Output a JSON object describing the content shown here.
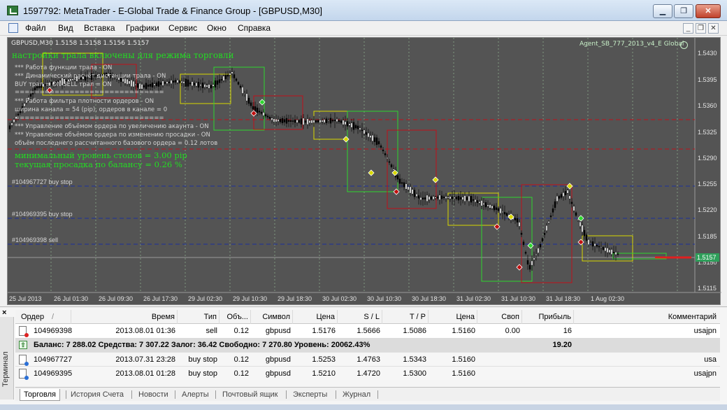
{
  "window": {
    "title": "1597792: MetaTrader - E-Global Trade & Finance Group - [GBPUSD,M30]",
    "min": "▁",
    "max": "❐",
    "close": "✕"
  },
  "menu": {
    "items": [
      "Файл",
      "Вид",
      "Вставка",
      "Графики",
      "Сервис",
      "Окно",
      "Справка"
    ],
    "mdi_min": "_",
    "mdi_restore": "❐",
    "mdi_close": "✕"
  },
  "chart": {
    "symbol_info": "GBPUSD,M30  1.5158 1.5158 1.5156 1.5157",
    "expert_name": "Agent_SB_777_2013_v4_E Global",
    "trail_heading": "настройки трала включены для режима  торговли",
    "info_lines": [
      "*** Работа функции трала -   ON",
      "*** Динамический расчёт дистанции трала -   ON",
      "BUY трал = ON  SELL трал = ON",
      "==============================",
      "*** Работа фильтра плотности ордеров -   ON",
      "ширина канала = 54 (pip), ордеров в канале =  0",
      "==============================",
      "*** Управление объёмом ордера по увеличению акаунта -   ON",
      "*** Управление объёмом ордера по изменению просадки -   ON",
      "объём последнего рассчитанного базового ордера = 0.12 лотов"
    ],
    "min_stop_level": "минимальный уровень стопов =  3.00 pip",
    "drawdown": "текущая просадка по балансу =  0.26 %",
    "order_labels": [
      "#104967727 buy stop",
      "#104969395 buy stop",
      "#104969398 sell"
    ],
    "price_ticks": [
      "1.5430",
      "1.5395",
      "1.5360",
      "1.5325",
      "1.5290",
      "1.5255",
      "1.5220",
      "1.5185",
      "1.5150",
      "1.5115"
    ],
    "current_price": "1.5157",
    "time_ticks": [
      "25 Jul 2013",
      "26 Jul 01:30",
      "26 Jul 09:30",
      "26 Jul 17:30",
      "29 Jul 02:30",
      "29 Jul 10:30",
      "29 Jul 18:30",
      "30 Jul 02:30",
      "30 Jul 10:30",
      "30 Jul 18:30",
      "31 Jul 02:30",
      "31 Jul 10:30",
      "31 Jul 18:30",
      "1 Aug 02:30"
    ],
    "colors": {
      "background": "#545454",
      "bull_candle": "#000000",
      "bear_candle": "#000000",
      "text_green": "#22dd22",
      "buy_level": "#1b2f9c",
      "sell_level": "#c0101a"
    }
  },
  "terminal": {
    "close": "×",
    "side_label": "Терминал",
    "columns": [
      "Ордер",
      "/",
      "Время",
      "Тип",
      "Объ...",
      "Символ",
      "Цена",
      "S / L",
      "T / P",
      "Цена",
      "Своп",
      "Прибыль",
      "Комментарий"
    ],
    "orders": [
      {
        "order": "104969398",
        "time": "2013.08.01 01:36",
        "type": "sell",
        "volume": "0.12",
        "symbol": "gbpusd",
        "price": "1.5176",
        "sl": "1.5666",
        "tp": "1.5086",
        "cur_price": "1.5160",
        "swap": "0.00",
        "profit": "16",
        "comment": "usajpn"
      }
    ],
    "summary": {
      "text": "Баланс: 7 288.02  Средства: 7 307.22  Залог: 36.42  Свободно: 7 270.80  Уровень: 20062.43%",
      "profit": "19.20"
    },
    "pending": [
      {
        "order": "104967727",
        "time": "2013.07.31 23:28",
        "type": "buy stop",
        "volume": "0.12",
        "symbol": "gbpusd",
        "price": "1.5253",
        "sl": "1.4763",
        "tp": "1.5343",
        "cur_price": "1.5160",
        "comment": "usa"
      },
      {
        "order": "104969395",
        "time": "2013.08.01 01:28",
        "type": "buy stop",
        "volume": "0.12",
        "symbol": "gbpusd",
        "price": "1.5210",
        "sl": "1.4720",
        "tp": "1.5300",
        "cur_price": "1.5160",
        "comment": "usajpn"
      }
    ],
    "tabs": [
      "Торговля",
      "История Счета",
      "Новости",
      "Алерты",
      "Почтовый ящик",
      "Эксперты",
      "Журнал"
    ]
  }
}
